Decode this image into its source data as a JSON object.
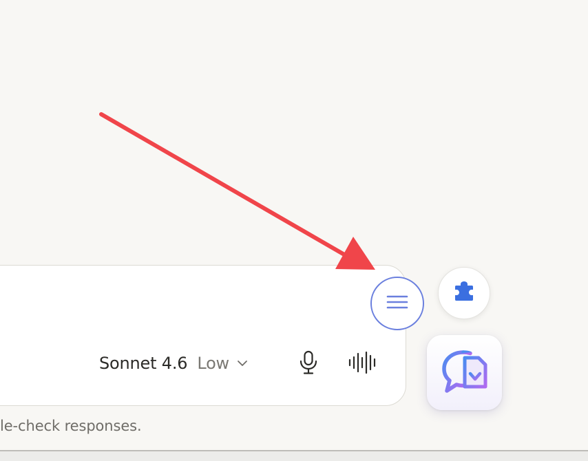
{
  "composer": {
    "model_name": "Sonnet 4.6",
    "model_effort": "Low",
    "disclaimer": "le-check responses."
  },
  "icons": {
    "model_dropdown": "chevron-down-icon",
    "microphone": "microphone-icon",
    "voice_mode": "sound-wave-icon",
    "menu": "hamburger-menu-icon",
    "extension": "puzzle-piece-icon",
    "app": "chat-download-icon"
  },
  "colors": {
    "annotation_arrow": "#f0454a",
    "menu_ring": "#6a7fde",
    "extension_icon": "#3b6fe0",
    "app_gradient_start": "#4a8cf0",
    "app_gradient_end": "#b06af0"
  }
}
